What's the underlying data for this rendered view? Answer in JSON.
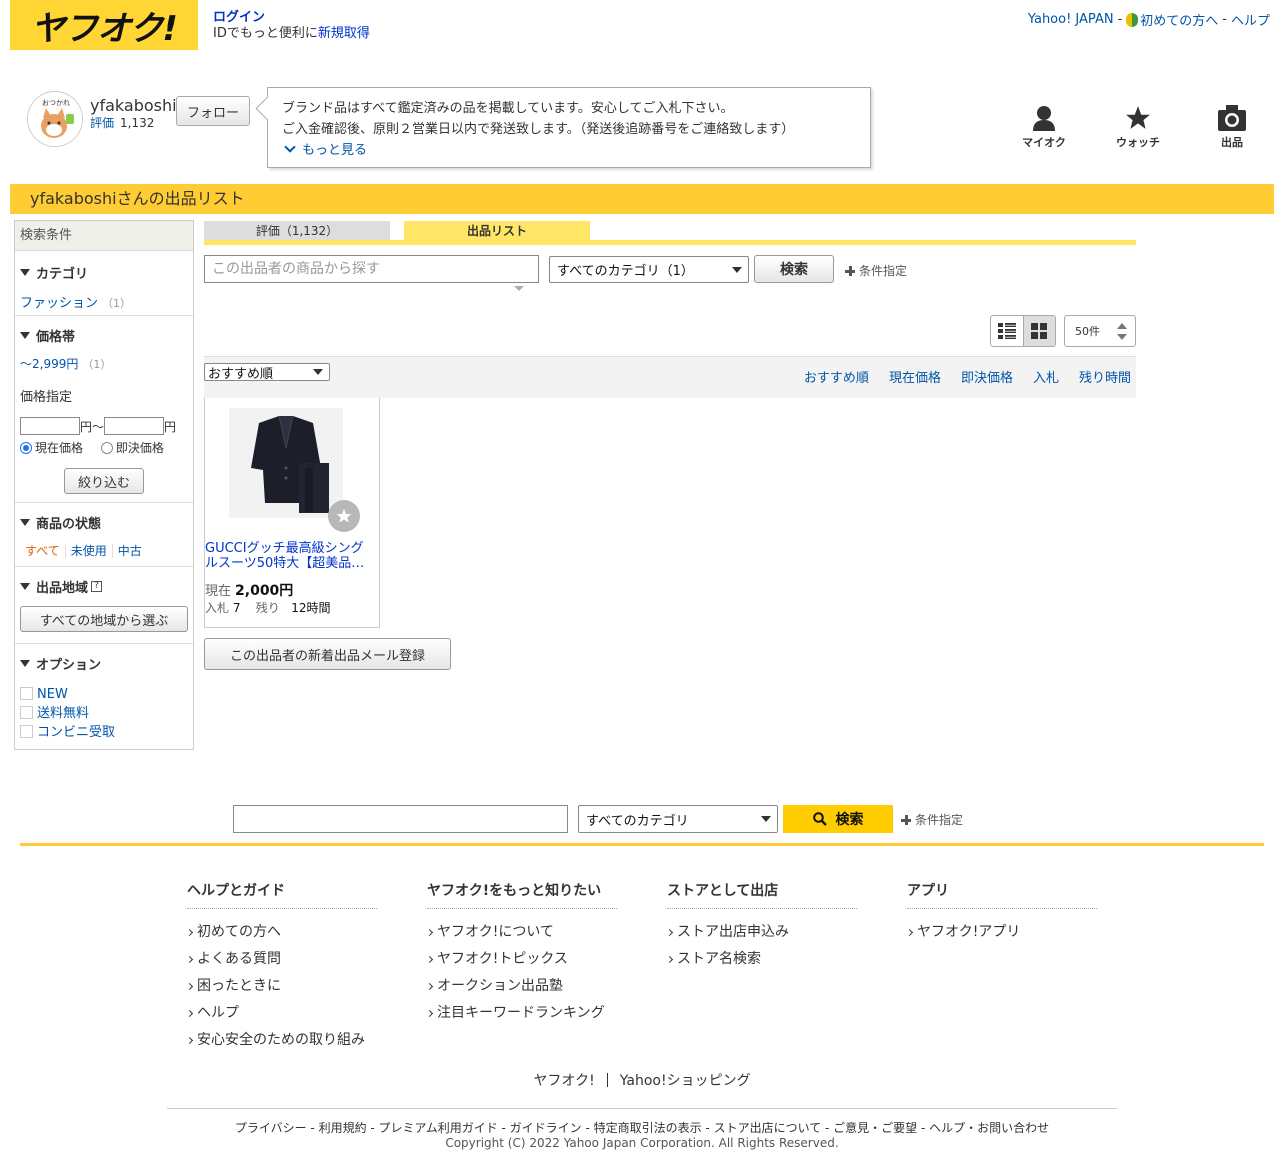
{
  "header": {
    "logo_text": "ヤフオク!",
    "login_label": "ログイン",
    "login_sub": "IDでもっと便利に",
    "register_label": "新規取得",
    "links": [
      "Yahoo! JAPAN",
      "初めての方へ",
      "ヘルプ"
    ],
    "sep": "-"
  },
  "seller": {
    "name": "yfakaboshi",
    "rating_label": "評価",
    "rating_value": "1,132",
    "follow_label": "フォロー",
    "notice_line1": "ブランド品はすべて鑑定済みの品を掲載しています。安心してご入札下さい。",
    "notice_line2": "ご入金確認後、原則２営業日以内で発送致します。（発送後追跡番号をご連絡致します）",
    "more_label": "もっと見る"
  },
  "topnav": {
    "myauc": "マイオク",
    "watch": "ウォッチ",
    "sell": "出品"
  },
  "page_title": "yfakaboshiさんの出品リスト",
  "sidebar": {
    "header": "検索条件",
    "category_title": "カテゴリ",
    "category_item": "ファッション",
    "category_count": "（1）",
    "price_title": "価格帯",
    "price_item": "〜2,999円",
    "price_count": "（1）",
    "price_specify": "価格指定",
    "yen": "円",
    "yen_tilde": "円～",
    "radio_current": "現在価格",
    "radio_buynow": "即決価格",
    "narrow_btn": "絞り込む",
    "condition_title": "商品の状態",
    "cond_all": "すべて",
    "cond_unused": "未使用",
    "cond_used": "中古",
    "region_title": "出品地域",
    "region_help": "?",
    "region_btn": "すべての地域から選ぶ",
    "option_title": "オプション",
    "opt_new": "NEW",
    "opt_free_ship": "送料無料",
    "opt_conveni": "コンビニ受取"
  },
  "tabs": {
    "rating": "評価（1,132）",
    "listing": "出品リスト"
  },
  "search": {
    "placeholder": "この出品者の商品から探す",
    "category_select": "すべてのカテゴリ（1）",
    "button": "検索",
    "cond_label": "条件指定"
  },
  "per_page": "50件",
  "sort": {
    "select": "おすすめ順",
    "links": [
      "おすすめ順",
      "現在価格",
      "即決価格",
      "入札",
      "残り時間"
    ]
  },
  "item": {
    "title": "GUCCIグッチ最高級シングルスーツ50特大【超美品…",
    "price_label": "現在",
    "price": "2,000円",
    "bids_label": "入札",
    "bids": "7",
    "remaining_label": "残り",
    "remaining": "12時間"
  },
  "mail_btn": "この出品者の新着出品メール登録",
  "footer_search": {
    "category_select": "すべてのカテゴリ",
    "button": "検索",
    "cond_label": "条件指定"
  },
  "footer": {
    "cols": [
      {
        "title": "ヘルプとガイド",
        "items": [
          "初めての方へ",
          "よくある質問",
          "困ったときに",
          "ヘルプ",
          "安心安全のための取り組み"
        ]
      },
      {
        "title": "ヤフオク!をもっと知りたい",
        "items": [
          "ヤフオク!について",
          "ヤフオク!トピックス",
          "オークション出品塾",
          "注目キーワードランキング"
        ]
      },
      {
        "title": "ストアとして出店",
        "items": [
          "ストア出店申込み",
          "ストア名検索"
        ]
      },
      {
        "title": "アプリ",
        "items": [
          "ヤフオク!アプリ"
        ]
      }
    ],
    "sites": [
      "ヤフオク!",
      "Yahoo!ショッピング"
    ],
    "legal": "プライバシー - 利用規約 - プレミアム利用ガイド - ガイドライン - 特定商取引法の表示 - ストア出店について - ご意見・ご要望 - ヘルプ・お問い合わせ",
    "copyright": "Copyright (C) 2022 Yahoo Japan Corporation. All Rights Reserved."
  },
  "colors": {
    "brand_yellow": "#ffcc33",
    "link_blue": "#0033cc"
  }
}
